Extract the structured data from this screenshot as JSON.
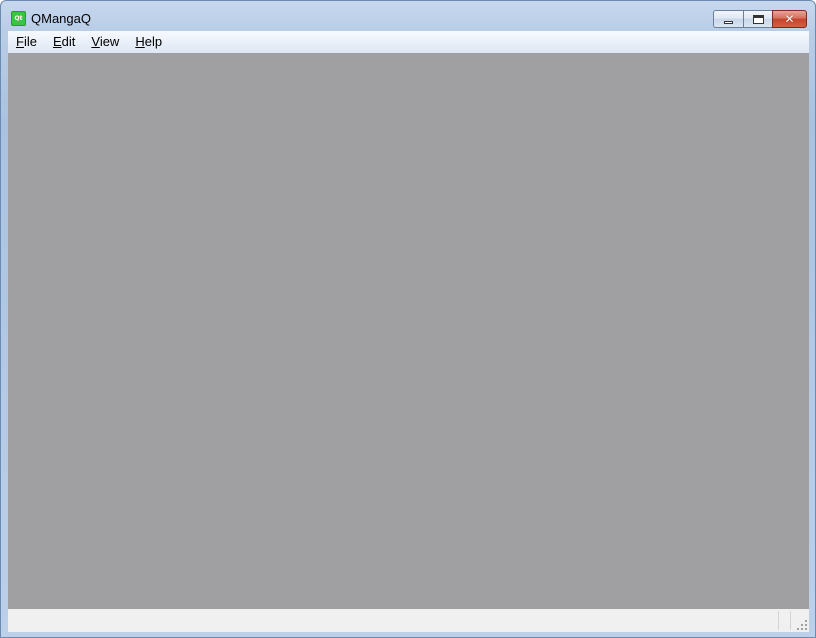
{
  "window": {
    "title": "QMangaQ",
    "app_icon_text": "Qt",
    "caption_buttons": {
      "minimize": "minimize-icon",
      "maximize": "maximize-icon",
      "close": "close-icon"
    }
  },
  "menubar": {
    "items": [
      {
        "mnemonic": "F",
        "rest": "ile"
      },
      {
        "mnemonic": "E",
        "rest": "dit"
      },
      {
        "mnemonic": "V",
        "rest": "iew"
      },
      {
        "mnemonic": "H",
        "rest": "elp"
      }
    ]
  },
  "colors": {
    "client_area": "#a09fa2",
    "statusbar": "#f0f0f0",
    "close_button": "#c4442d"
  }
}
